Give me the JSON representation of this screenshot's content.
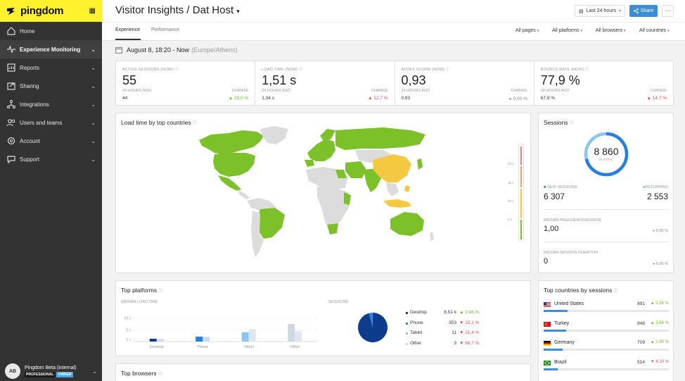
{
  "sidebar": {
    "brand": "pingdom",
    "items": [
      {
        "label": "Home",
        "icon": "home-icon"
      },
      {
        "label": "Experience Monitoring",
        "icon": "pulse-icon"
      },
      {
        "label": "Reports",
        "icon": "reports-icon"
      },
      {
        "label": "Sharing",
        "icon": "share-icon"
      },
      {
        "label": "Integrations",
        "icon": "integrations-icon"
      },
      {
        "label": "Users and teams",
        "icon": "users-icon"
      },
      {
        "label": "Account",
        "icon": "gear-icon"
      },
      {
        "label": "Support",
        "icon": "support-icon"
      }
    ],
    "user": {
      "initials": "AB",
      "name": "Pingdom Beta (internal)",
      "badge1": "PROFESSIONAL",
      "badge2": "OWNER"
    }
  },
  "header": {
    "title": "Visitor Insights / Dat Host",
    "time_range": "Last 24 hours",
    "share": "Share",
    "more": "···",
    "tabs": [
      "Experience",
      "Performance"
    ],
    "filters": [
      "All pages",
      "All platforms",
      "All browsers",
      "All countries"
    ]
  },
  "date": {
    "range": "August 8, 18:20 - Now",
    "tz": "(Europe/Athens)"
  },
  "kpis": [
    {
      "label": "ACTIVE SESSIONS (NOW)",
      "value": "55",
      "sub_label": "24 HOURS AGO",
      "sub_value": "44",
      "change_label": "CHANGE",
      "change": "▲ 25,0 %",
      "trend": "up-green"
    },
    {
      "label": "LOAD TIME (NOW)",
      "value": "1,51 s",
      "sub_label": "24 HOURS AGO",
      "sub_value": "1,34 s",
      "change_label": "CHANGE",
      "change": "▲ 12,7 %",
      "trend": "up-red"
    },
    {
      "label": "APDEX SCORE (NOW)",
      "value": "0,93",
      "sub_label": "24 HOURS AGO",
      "sub_value": "0,93",
      "change_label": "CHANGE",
      "change": "▸ 0,00 %",
      "trend": "flat"
    },
    {
      "label": "BOUNCE RATE (NOW)",
      "value": "77,9 %",
      "sub_label": "24 HOURS AGO",
      "sub_value": "67,9 %",
      "change_label": "CHANGE",
      "change": "▲ 14,7 %",
      "trend": "up-red"
    }
  ],
  "map": {
    "title": "Load time by top countries",
    "scale_labels": [
      "20 s",
      "15 s",
      "10 s",
      "5 s"
    ],
    "colors": {
      "fast": "#7cc02a",
      "slow": "#f5c842",
      "none": "#dcdcdc"
    }
  },
  "sessions": {
    "title": "Sessions",
    "total": "8 860",
    "total_caption": "IN TOTAL",
    "new_label": "NEW SESSIONS",
    "new_value": "6 307",
    "returning_label": "RETURNING",
    "returning_value": "2 553",
    "new_share": 0.712,
    "pageviews_label": "MEDIAN PAGEVIEWS/SESSION",
    "pageviews_value": "1,00",
    "pageviews_change": "▸ 0,00 %",
    "duration_label": "MEDIAN SESSION DURATION",
    "duration_value": "0",
    "duration_change": "▸ 0,00 %"
  },
  "platforms": {
    "title": "Top platforms",
    "load_label": "MEDIAN LOAD TIME",
    "sessions_label": "SESSIONS",
    "rows": [
      {
        "name": "Desktop",
        "value": "8,51 k",
        "change": "▲ 2,46 %",
        "trend": "up-green",
        "color": "#0d3c8c"
      },
      {
        "name": "Phone",
        "value": "353",
        "change": "▼ 15,1 %",
        "trend": "up-red",
        "color": "#2a7fdc"
      },
      {
        "name": "Tablet",
        "value": "11",
        "change": "▼ 21,4 %",
        "trend": "up-red",
        "color": "#8cc6f0"
      },
      {
        "name": "Other",
        "value": "3",
        "change": "▼ 66,7 %",
        "trend": "up-red",
        "color": "#cfd8e0"
      }
    ]
  },
  "chart_data": {
    "type": "bar",
    "categories": [
      "Desktop",
      "Phone",
      "Tablet",
      "Other"
    ],
    "yticks": [
      "10 s",
      "5 s",
      "1 s"
    ],
    "series": [
      {
        "name": "",
        "values": [
          1.2,
          2.1,
          4.0,
          7.5
        ]
      },
      {
        "name": "",
        "values": [
          1.1,
          2.0,
          5.3,
          4.4
        ]
      }
    ],
    "ylim": [
      0,
      12
    ]
  },
  "pie_data": {
    "type": "pie",
    "categories": [
      "Desktop",
      "Phone",
      "Tablet",
      "Other"
    ],
    "values": [
      8510,
      353,
      11,
      3
    ]
  },
  "countries": {
    "title": "Top countries by sessions",
    "rows": [
      {
        "name": "United States",
        "value": "891",
        "change": "▲ 3,36 %",
        "trend": "up-green",
        "share": 0.19
      },
      {
        "name": "Turkey",
        "value": "848",
        "change": "▲ 3,54 %",
        "trend": "up-green",
        "share": 0.18
      },
      {
        "name": "Germany",
        "value": "709",
        "change": "▲ 2,90 %",
        "trend": "up-green",
        "share": 0.15
      },
      {
        "name": "Brazil",
        "value": "514",
        "change": "▼ 4,10 %",
        "trend": "up-red",
        "share": 0.11
      }
    ]
  },
  "browsers": {
    "title": "Top browsers"
  }
}
